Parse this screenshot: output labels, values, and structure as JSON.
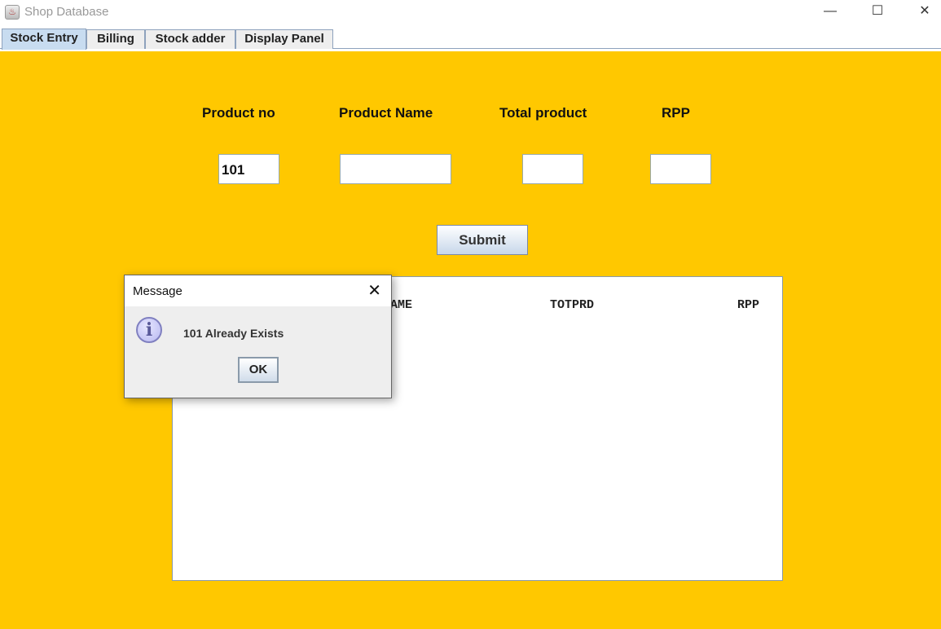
{
  "window": {
    "title": "Shop Database",
    "minimize": "—",
    "maximize": "☐",
    "close": "✕"
  },
  "tabs": [
    "Stock Entry",
    "Billing",
    "Stock adder",
    "Display Panel"
  ],
  "form": {
    "labels": [
      "Product no",
      "Product Name",
      "Total product",
      "RPP"
    ],
    "values": {
      "product_no": "101",
      "product_name": "",
      "total_product": "",
      "rpp": ""
    },
    "submit": "Submit"
  },
  "table": {
    "headers": [
      "PNAME",
      "TOTPRD",
      "RPP"
    ]
  },
  "dialog": {
    "title": "Message",
    "message": "101 Already Exists",
    "ok": "OK",
    "close": "✕",
    "icon": "i"
  },
  "colors": {
    "panel": "#ffc800",
    "active_tab": "#c8dcf0"
  }
}
